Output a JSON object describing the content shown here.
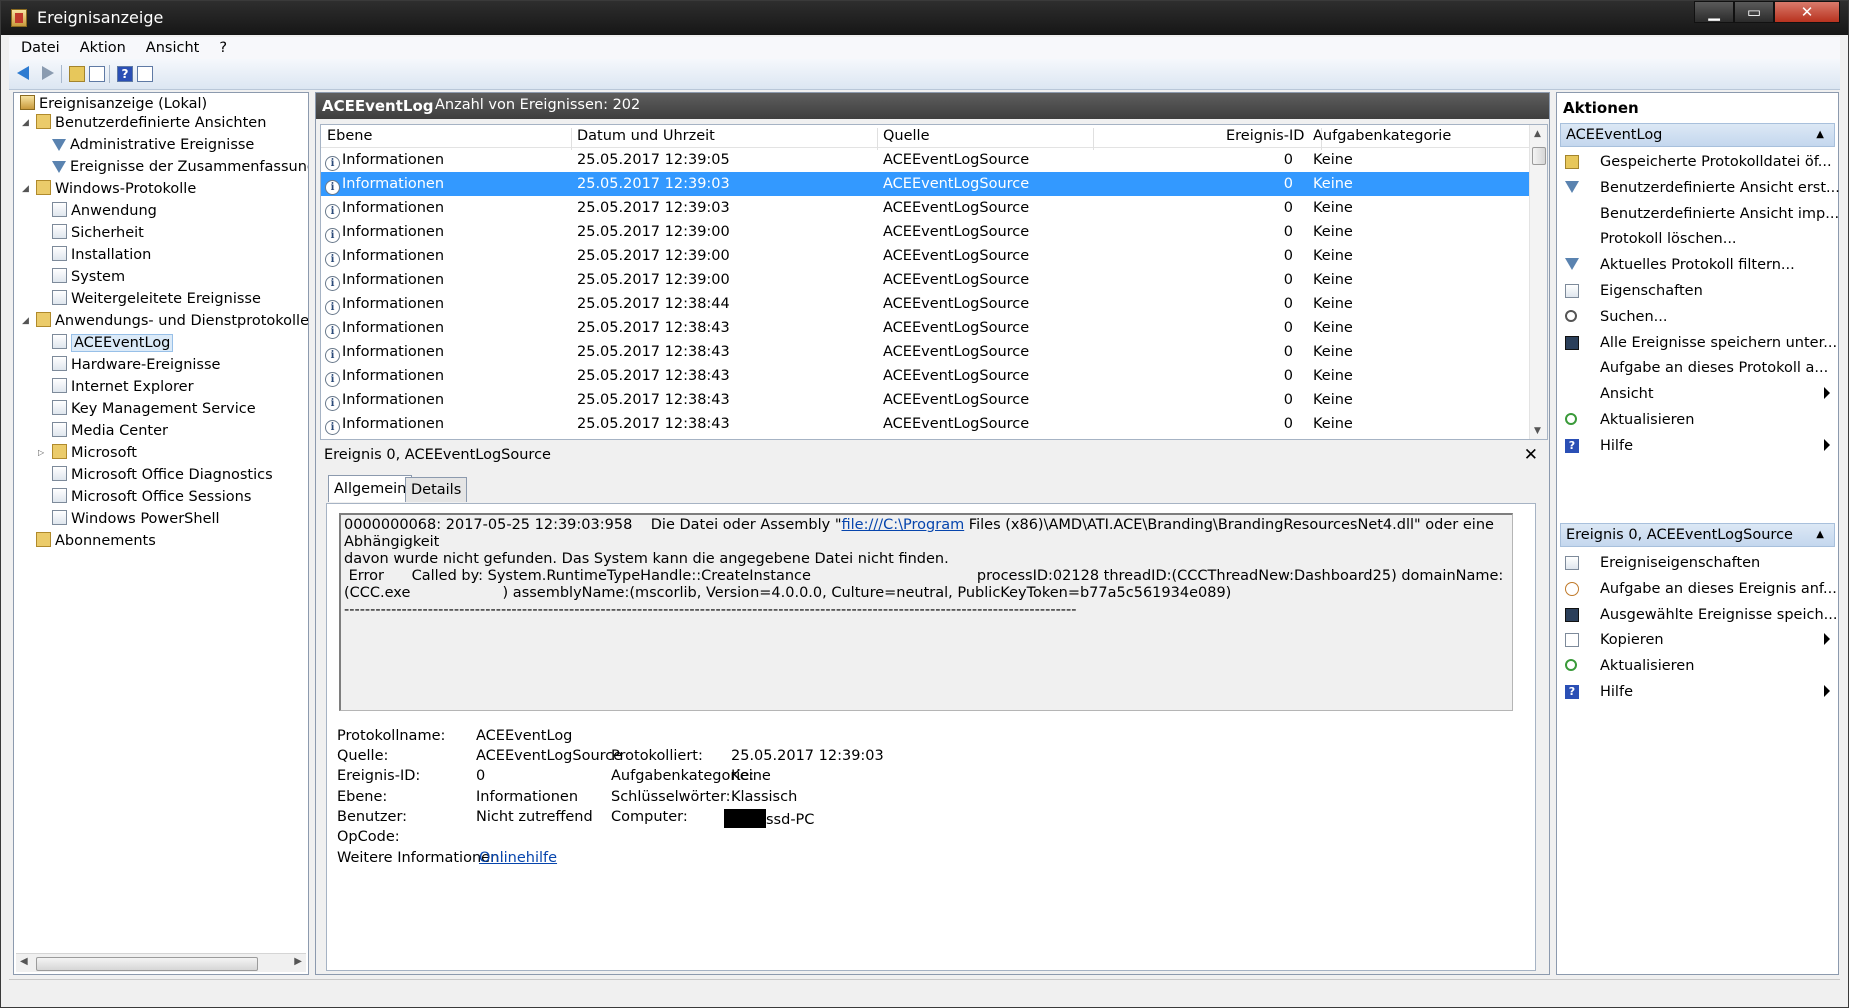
{
  "window": {
    "title": "Ereignisanzeige"
  },
  "menu": [
    "Datei",
    "Aktion",
    "Ansicht",
    "?"
  ],
  "tree": {
    "root": "Ereignisanzeige (Lokal)",
    "custom_views": "Benutzerdefinierte Ansichten",
    "admin_events": "Administrative Ereignisse",
    "summary_events": "Ereignisse der Zusammenfassungsseite",
    "windows_logs": "Windows-Protokolle",
    "application": "Anwendung",
    "security": "Sicherheit",
    "installation": "Installation",
    "system": "System",
    "forwarded": "Weitergeleitete Ereignisse",
    "app_service_logs": "Anwendungs- und Dienstprotokolle",
    "ace": "ACEEventLog",
    "hardware": "Hardware-Ereignisse",
    "ie": "Internet Explorer",
    "kms": "Key Management Service",
    "media": "Media Center",
    "microsoft": "Microsoft",
    "office_diag": "Microsoft Office Diagnostics",
    "office_sessions": "Microsoft Office Sessions",
    "powershell": "Windows PowerShell",
    "subscriptions": "Abonnements"
  },
  "log": {
    "name": "ACEEventLog",
    "count_label": "Anzahl von Ereignissen: 202"
  },
  "grid": {
    "headers": {
      "level": "Ebene",
      "date": "Datum und Uhrzeit",
      "source": "Quelle",
      "id": "Ereignis-ID",
      "category": "Aufgabenkategorie"
    },
    "rows": [
      {
        "level": "Informationen",
        "date": "25.05.2017 12:39:05",
        "source": "ACEEventLogSource",
        "id": "0",
        "category": "Keine"
      },
      {
        "level": "Informationen",
        "date": "25.05.2017 12:39:03",
        "source": "ACEEventLogSource",
        "id": "0",
        "category": "Keine"
      },
      {
        "level": "Informationen",
        "date": "25.05.2017 12:39:03",
        "source": "ACEEventLogSource",
        "id": "0",
        "category": "Keine"
      },
      {
        "level": "Informationen",
        "date": "25.05.2017 12:39:00",
        "source": "ACEEventLogSource",
        "id": "0",
        "category": "Keine"
      },
      {
        "level": "Informationen",
        "date": "25.05.2017 12:39:00",
        "source": "ACEEventLogSource",
        "id": "0",
        "category": "Keine"
      },
      {
        "level": "Informationen",
        "date": "25.05.2017 12:39:00",
        "source": "ACEEventLogSource",
        "id": "0",
        "category": "Keine"
      },
      {
        "level": "Informationen",
        "date": "25.05.2017 12:38:44",
        "source": "ACEEventLogSource",
        "id": "0",
        "category": "Keine"
      },
      {
        "level": "Informationen",
        "date": "25.05.2017 12:38:43",
        "source": "ACEEventLogSource",
        "id": "0",
        "category": "Keine"
      },
      {
        "level": "Informationen",
        "date": "25.05.2017 12:38:43",
        "source": "ACEEventLogSource",
        "id": "0",
        "category": "Keine"
      },
      {
        "level": "Informationen",
        "date": "25.05.2017 12:38:43",
        "source": "ACEEventLogSource",
        "id": "0",
        "category": "Keine"
      },
      {
        "level": "Informationen",
        "date": "25.05.2017 12:38:43",
        "source": "ACEEventLogSource",
        "id": "0",
        "category": "Keine"
      },
      {
        "level": "Informationen",
        "date": "25.05.2017 12:38:43",
        "source": "ACEEventLogSource",
        "id": "0",
        "category": "Keine"
      }
    ],
    "selected_index": 1
  },
  "detail": {
    "title": "Ereignis 0, ACEEventLogSource",
    "tab_general": "Allgemein",
    "tab_details": "Details",
    "msg_line1_pre": "0000000068: 2017-05-25 12:39:03:958    Die Datei oder Assembly \"",
    "msg_link": "file:///C:\\Program",
    "msg_line1_post": " Files (x86)\\AMD\\ATI.ACE\\Branding\\BrandingResourcesNet4.dll\" oder eine Abhängigkeit",
    "msg_line2": "davon wurde nicht gefunden. Das System kann die angegebene Datei nicht finden.",
    "msg_line3": " Error      Called by: System.RuntimeTypeHandle::CreateInstance                                    processID:02128 threadID:(CCCThreadNew:Dashboard25) domainName:",
    "msg_line4": "(CCC.exe                    ) assemblyName:(mscorlib, Version=4.0.0.0, Culture=neutral, PublicKeyToken=b77a5c561934e089)",
    "msg_line5": "--------------------------------------------------------------------------------------------------------------------------------------------",
    "labels": {
      "log_name": "Protokollname:",
      "source": "Quelle:",
      "event_id": "Ereignis-ID:",
      "level": "Ebene:",
      "user": "Benutzer:",
      "opcode": "OpCode:",
      "more_info": "Weitere Informationen:",
      "logged": "Protokolliert:",
      "task_category": "Aufgabenkategorie:",
      "keywords": "Schlüsselwörter:",
      "computer": "Computer:"
    },
    "values": {
      "log_name": "ACEEventLog",
      "source": "ACEEventLogSource",
      "event_id": "0",
      "level": "Informationen",
      "user": "Nicht zutreffend",
      "more_info_link": "Onlinehilfe",
      "logged": "25.05.2017 12:39:03",
      "task_category": "Keine",
      "keywords": "Klassisch",
      "computer_suffix": "ssd-PC"
    }
  },
  "actions": {
    "title": "Aktionen",
    "section1": "ACEEventLog",
    "items1": [
      "Gespeicherte Protokolldatei öf...",
      "Benutzerdefinierte Ansicht erst...",
      "Benutzerdefinierte Ansicht imp...",
      "Protokoll löschen...",
      "Aktuelles Protokoll filtern...",
      "Eigenschaften",
      "Suchen...",
      "Alle Ereignisse speichern unter...",
      "Aufgabe an dieses Protokoll a...",
      "Ansicht",
      "Aktualisieren",
      "Hilfe"
    ],
    "section2": "Ereignis 0, ACEEventLogSource",
    "items2": [
      "Ereigniseigenschaften",
      "Aufgabe an dieses Ereignis anf...",
      "Ausgewählte Ereignisse speich...",
      "Kopieren",
      "Aktualisieren",
      "Hilfe"
    ]
  }
}
